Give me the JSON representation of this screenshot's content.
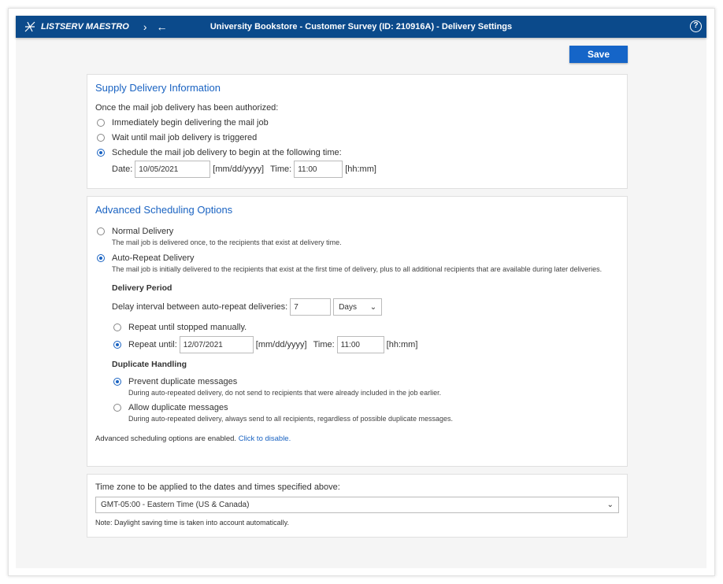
{
  "header": {
    "brand": "LISTSERV MAESTRO",
    "title": "University Bookstore - Customer Survey (ID: 210916A) - Delivery Settings",
    "help": "?"
  },
  "toolbar": {
    "save_label": "Save"
  },
  "supply": {
    "title": "Supply Delivery Information",
    "intro": "Once the mail job delivery has been authorized:",
    "options": [
      "Immediately begin delivering the mail job",
      "Wait until mail job delivery is triggered",
      "Schedule the mail job delivery to begin at the following time:"
    ],
    "date_label": "Date:",
    "date_value": "10/05/2021",
    "date_format": "[mm/dd/yyyy]",
    "time_label": "Time:",
    "time_value": "11:00",
    "time_format": "[hh:mm]"
  },
  "advanced": {
    "title": "Advanced Scheduling Options",
    "normal_label": "Normal Delivery",
    "normal_desc": "The mail job is delivered once, to the recipients that exist at delivery time.",
    "auto_label": "Auto-Repeat Delivery",
    "auto_desc": "The mail job is initially delivered to the recipients that exist at the first time of delivery, plus to all additional recipients that are available during later deliveries.",
    "period_title": "Delivery Period",
    "interval_label": "Delay interval between auto-repeat deliveries:",
    "interval_value": "7",
    "interval_unit": "Days",
    "repeat_manual": "Repeat until stopped manually.",
    "repeat_until": "Repeat until:",
    "until_date": "12/07/2021",
    "date_format": "[mm/dd/yyyy]",
    "time_label": "Time:",
    "until_time": "11:00",
    "time_format": "[hh:mm]",
    "dup_title": "Duplicate Handling",
    "prevent_label": "Prevent duplicate messages",
    "prevent_desc": "During auto-repeated delivery, do not send to recipients that were already included in the job earlier.",
    "allow_label": "Allow duplicate messages",
    "allow_desc": "During auto-repeated delivery, always send to all recipients, regardless of possible duplicate messages.",
    "status": "Advanced scheduling options are enabled.",
    "disable_link": "Click to disable."
  },
  "timezone": {
    "label": "Time zone to be applied to the dates and times specified above:",
    "value": "GMT-05:00 - Eastern Time (US & Canada)",
    "note": "Note: Daylight saving time is taken into account automatically."
  },
  "colors": {
    "header": "#0b4a8b",
    "accent": "#1a63c2",
    "button": "#1565c8"
  }
}
